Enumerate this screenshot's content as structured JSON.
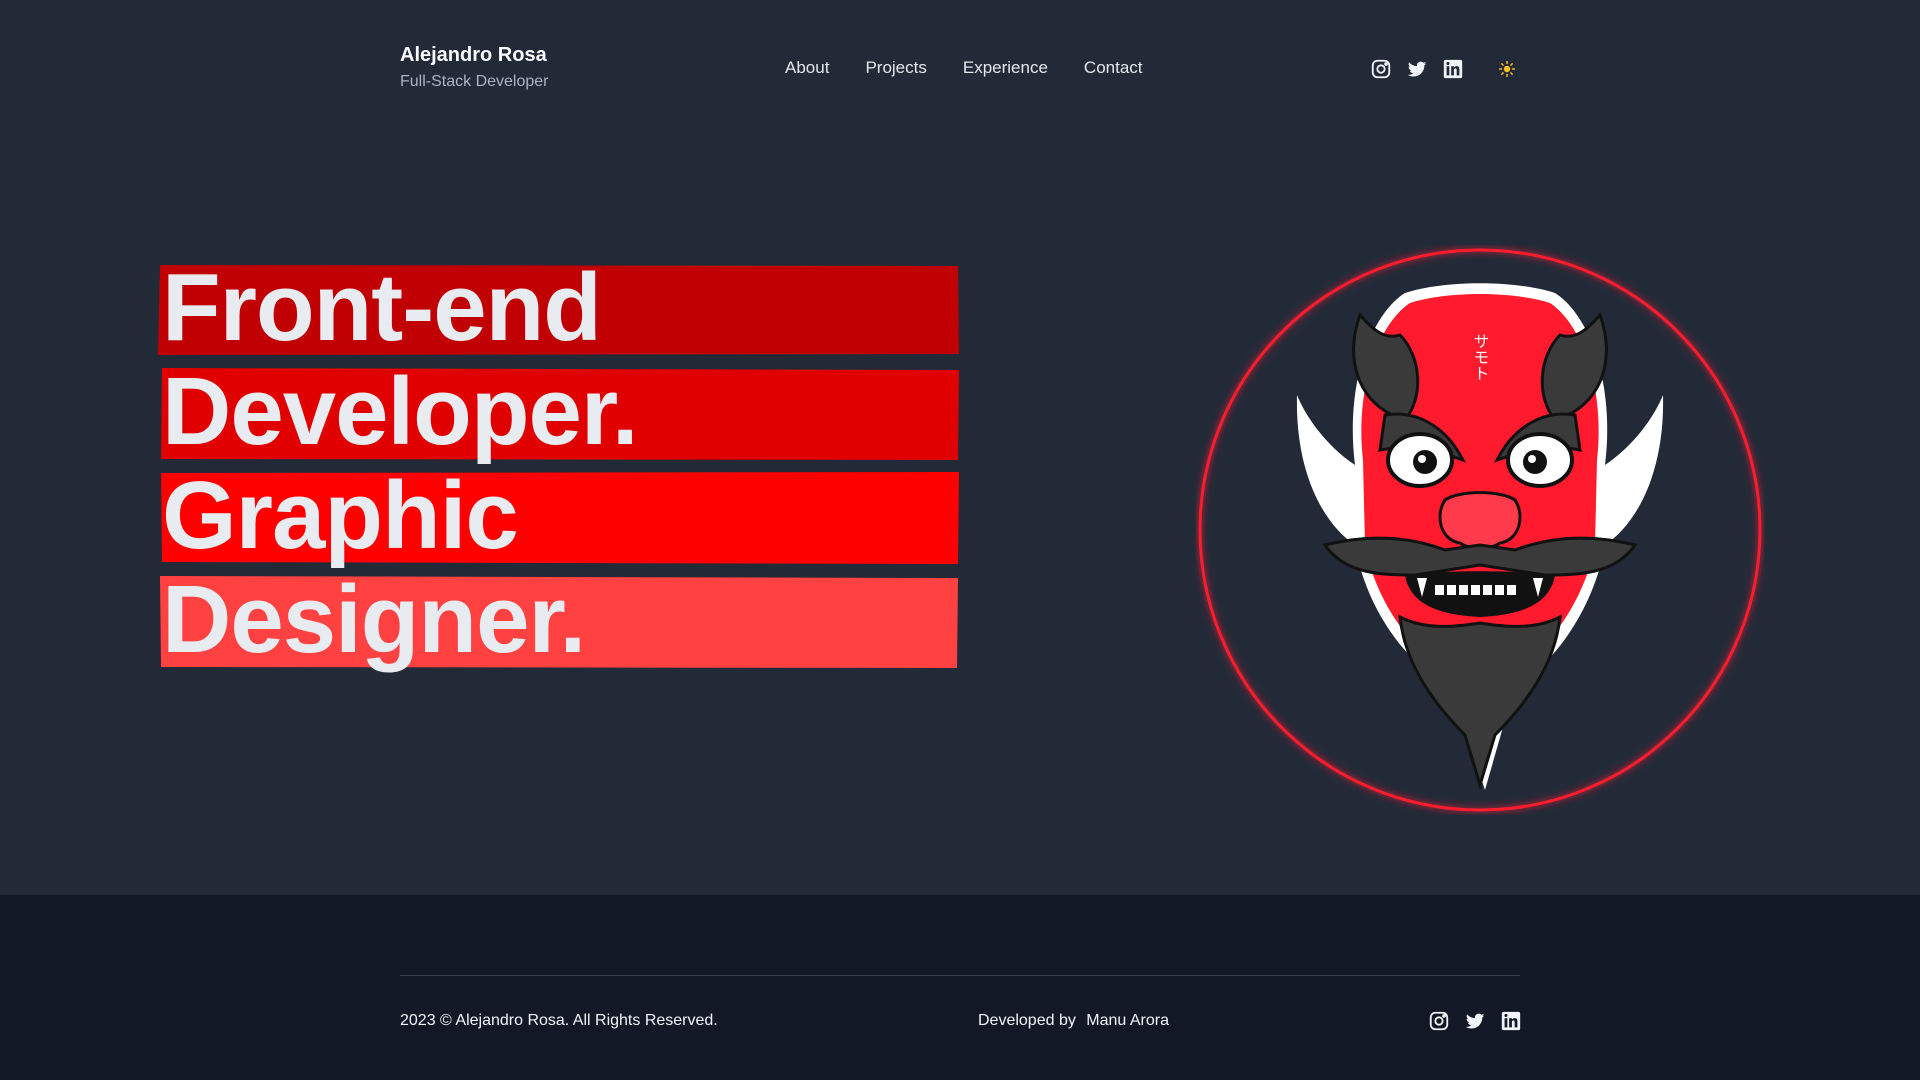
{
  "header": {
    "name": "Alejandro Rosa",
    "role": "Full-Stack Developer",
    "nav": [
      "About",
      "Projects",
      "Experience",
      "Contact"
    ],
    "social_icons": [
      "instagram-icon",
      "twitter-icon",
      "linkedin-icon"
    ],
    "theme_toggle_icon": "sun-icon"
  },
  "hero": {
    "lines": [
      "Front-end",
      "Developer.",
      "Graphic",
      "Designer."
    ],
    "bar_colors": [
      "#c10004",
      "#e00000",
      "#ff0000",
      "#ff4141"
    ],
    "mask_caption": "サモト"
  },
  "footer": {
    "copyright": "2023 © Alejandro Rosa. All Rights Reserved.",
    "developed_by_label": "Developed by",
    "developer_name": "Manu Arora",
    "social_icons": [
      "instagram-icon",
      "twitter-icon",
      "linkedin-icon"
    ]
  },
  "colors": {
    "background": "#222a38",
    "footer_background": "#121826",
    "accent": "#ff0000"
  }
}
